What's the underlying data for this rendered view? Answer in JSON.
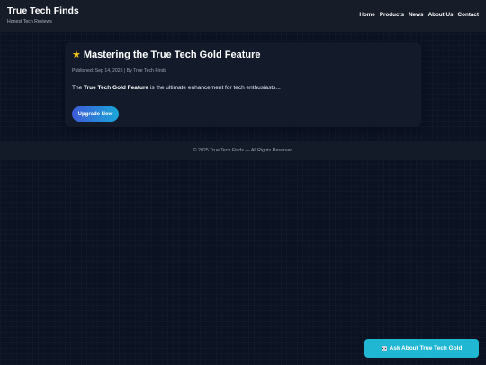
{
  "site": {
    "title": "True Tech Finds",
    "tagline": "Honest Tech Reviews"
  },
  "nav": {
    "items": [
      "Home",
      "Products",
      "News",
      "About Us",
      "Contact"
    ]
  },
  "article": {
    "title": "Mastering the True Tech Gold Feature",
    "meta": "Published: Sep 14, 2025 | By True Tech Finds",
    "body_prefix": "The ",
    "body_bold": "True Tech Gold Feature",
    "body_suffix": " is the ultimate enhancement for tech enthusiasts...",
    "button_label": "Upgrade Now"
  },
  "footer": {
    "text": "© 2025 True Tech Finds — All Rights Reserved"
  },
  "assistant": {
    "label": "Ask About True Tech Gold"
  },
  "colors": {
    "background": "#0b1222",
    "header": "#171c29",
    "card": "#131b2b",
    "accent_cyan": "#1fb7d2",
    "accent_blue": "#3e5bd8"
  },
  "icons": {
    "title_icon": "star-icon",
    "assistant_icon": "robot-icon"
  }
}
